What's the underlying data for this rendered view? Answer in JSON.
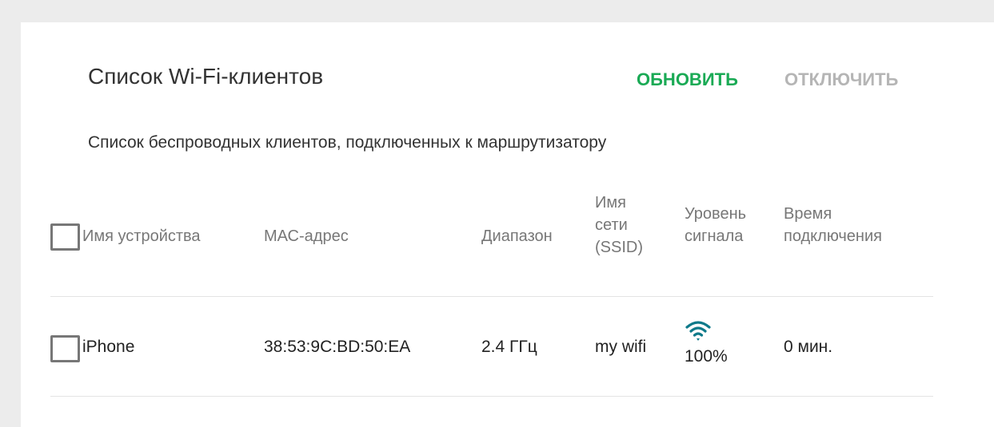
{
  "colors": {
    "accent": "#1aaa55",
    "disabled": "#b5b5b5",
    "signal_icon": "#0f7a8a"
  },
  "panel": {
    "title": "Список Wi-Fi-клиентов",
    "subtitle": "Список беспроводных клиентов, подключенных к маршрутизатору",
    "actions": {
      "refresh": "ОБНОВИТЬ",
      "disconnect": "ОТКЛЮЧИТЬ"
    }
  },
  "table": {
    "headers": {
      "device_name": "Имя устройства",
      "mac": "МАС-адрес",
      "band": "Диапазон",
      "ssid": "Имя сети (SSID)",
      "signal": "Уровень сигнала",
      "time": "Время подключения"
    },
    "rows": [
      {
        "device_name": "iPhone",
        "mac": "38:53:9C:BD:50:EA",
        "band": "2.4 ГГц",
        "ssid": "my wifi",
        "signal_icon": "wifi-icon",
        "signal": "100%",
        "time": "0 мин."
      }
    ]
  }
}
